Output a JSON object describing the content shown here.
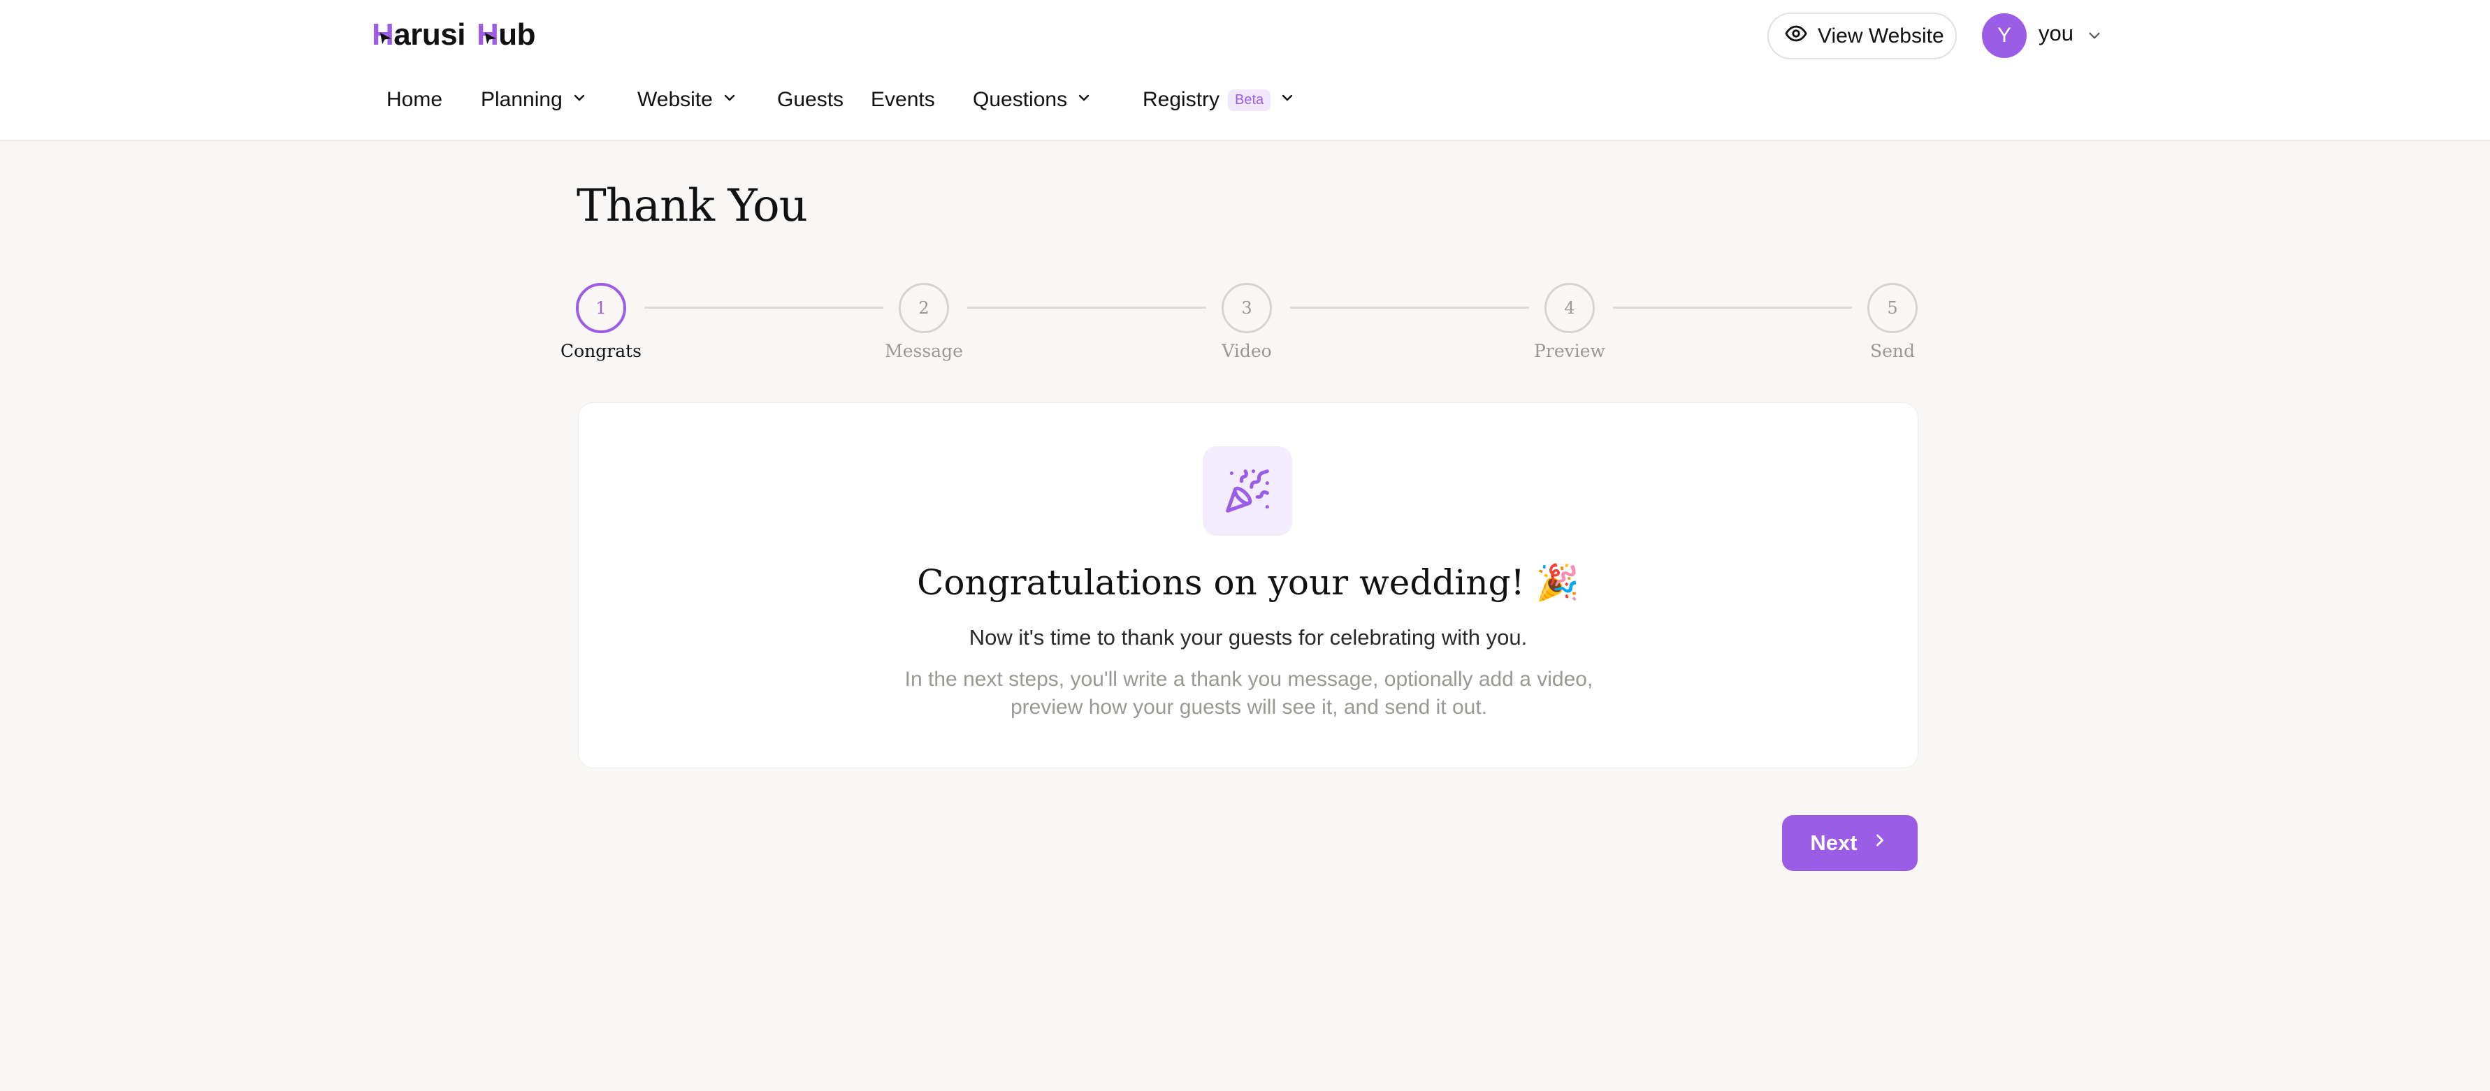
{
  "app": {
    "logo_part1": "arusi",
    "logo_part2": "ub",
    "logo_mark": "H",
    "accent_color": "#9b5de5"
  },
  "header": {
    "view_website_label": "View Website",
    "view_website_icon": "eye-icon",
    "avatar_initial": "Y",
    "user_name": "you"
  },
  "nav": {
    "items": [
      {
        "label": "Home",
        "has_dropdown": false
      },
      {
        "label": "Planning",
        "has_dropdown": true
      },
      {
        "label": "Website",
        "has_dropdown": true
      },
      {
        "label": "Guests",
        "has_dropdown": false
      },
      {
        "label": "Events",
        "has_dropdown": false
      },
      {
        "label": "Questions",
        "has_dropdown": true
      },
      {
        "label": "Registry",
        "has_dropdown": true,
        "badge": "Beta"
      }
    ]
  },
  "page": {
    "title": "Thank You"
  },
  "stepper": {
    "current_step": 1,
    "steps": [
      {
        "number": "1",
        "label": "Congrats"
      },
      {
        "number": "2",
        "label": "Message"
      },
      {
        "number": "3",
        "label": "Video"
      },
      {
        "number": "4",
        "label": "Preview"
      },
      {
        "number": "5",
        "label": "Send"
      }
    ]
  },
  "card": {
    "icon": "party-popper-icon",
    "heading": "Congratulations on your wedding! 🎉",
    "subheading": "Now it's time to thank your guests for celebrating with you.",
    "description": "In the next steps, you'll write a thank you message, optionally add a video, preview how your guests will see it, and send it out."
  },
  "actions": {
    "next_label": "Next"
  }
}
